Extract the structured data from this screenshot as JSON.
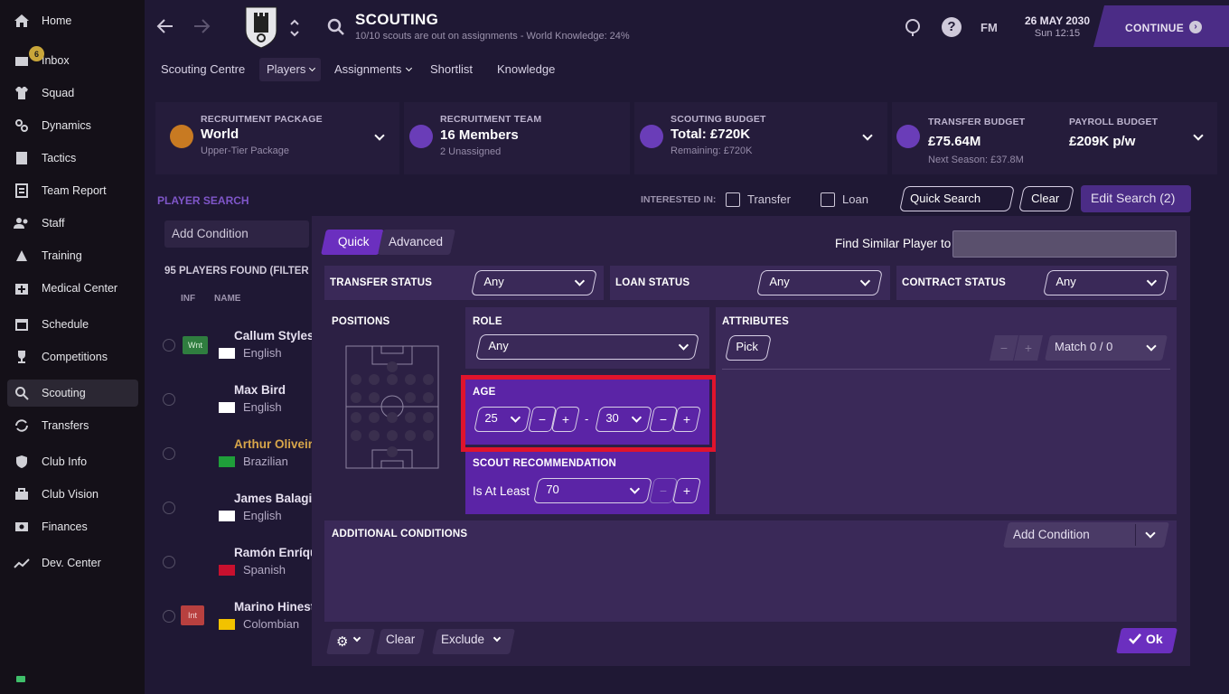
{
  "sidebar": {
    "items": [
      {
        "label": "Home",
        "icon": "home-icon"
      },
      {
        "label": "Inbox",
        "icon": "inbox-icon",
        "badge": "6"
      },
      {
        "label": "Squad",
        "icon": "shirt-icon"
      },
      {
        "label": "Dynamics",
        "icon": "dynamics-icon"
      },
      {
        "label": "Tactics",
        "icon": "tactics-icon"
      },
      {
        "label": "Team Report",
        "icon": "report-icon"
      },
      {
        "label": "Staff",
        "icon": "staff-icon"
      },
      {
        "label": "Training",
        "icon": "training-icon"
      },
      {
        "label": "Medical Center",
        "icon": "medical-icon"
      },
      {
        "label": "Schedule",
        "icon": "calendar-icon"
      },
      {
        "label": "Competitions",
        "icon": "trophy-icon"
      },
      {
        "label": "Scouting",
        "icon": "search-icon"
      },
      {
        "label": "Transfers",
        "icon": "transfer-icon"
      },
      {
        "label": "Club Info",
        "icon": "shield-icon"
      },
      {
        "label": "Club Vision",
        "icon": "briefcase-icon"
      },
      {
        "label": "Finances",
        "icon": "finances-icon"
      },
      {
        "label": "Dev. Center",
        "icon": "dev-icon"
      }
    ]
  },
  "header": {
    "title": "SCOUTING",
    "subtitle": "10/10 scouts are out on assignments - World Knowledge: 24%",
    "fm": "FM",
    "date": "26 MAY 2030",
    "time": "Sun 12:15",
    "continue": "CONTINUE"
  },
  "subtabs": {
    "scouting_centre": "Scouting Centre",
    "players": "Players",
    "assignments": "Assignments",
    "shortlist": "Shortlist",
    "knowledge": "Knowledge"
  },
  "cards": {
    "recruitment_package": {
      "label": "RECRUITMENT PACKAGE",
      "value": "World",
      "sub": "Upper-Tier Package"
    },
    "recruitment_team": {
      "label": "RECRUITMENT TEAM",
      "value": "16 Members",
      "sub": "2 Unassigned"
    },
    "scouting_budget": {
      "label": "SCOUTING BUDGET",
      "value": "Total: £720K",
      "sub": "Remaining: £720K"
    },
    "transfer_budget": {
      "label": "TRANSFER BUDGET",
      "value": "£75.64M",
      "sub": "Next Season: £37.8M"
    },
    "payroll_budget": {
      "label": "PAYROLL BUDGET",
      "value": "£209K p/w"
    }
  },
  "search_bar": {
    "title": "PLAYER SEARCH",
    "interested_in": "INTERESTED IN:",
    "transfer": "Transfer",
    "loan": "Loan",
    "quick_search": "Quick Search",
    "clear": "Clear",
    "edit_search": "Edit Search (2)",
    "add_condition": "Add Condition"
  },
  "list": {
    "found": "95 PLAYERS FOUND (FILTER",
    "col_inf": "INF",
    "col_name": "NAME",
    "rows": [
      {
        "name": "Callum Styles",
        "nat": "English",
        "tag": "Wnt"
      },
      {
        "name": "Max Bird",
        "nat": "English"
      },
      {
        "name": "Arthur Oliveir",
        "nat": "Brazilian"
      },
      {
        "name": "James Balagiz",
        "nat": "English"
      },
      {
        "name": "Ramón Enríqu",
        "nat": "Spanish"
      },
      {
        "name": "Marino Hinest",
        "nat": "Colombian",
        "tag": "Int"
      }
    ]
  },
  "modal": {
    "tab_quick": "Quick",
    "tab_advanced": "Advanced",
    "find_similar": "Find Similar Player to",
    "find_similar_value": "",
    "transfer_status": {
      "label": "TRANSFER STATUS",
      "value": "Any"
    },
    "loan_status": {
      "label": "LOAN STATUS",
      "value": "Any"
    },
    "contract_status": {
      "label": "CONTRACT STATUS",
      "value": "Any"
    },
    "positions": "POSITIONS",
    "role": {
      "label": "ROLE",
      "value": "Any"
    },
    "age": {
      "label": "AGE",
      "min": "25",
      "max": "30",
      "dash": "-"
    },
    "scout_rec": {
      "label": "SCOUT RECOMMENDATION",
      "op": "Is At Least",
      "value": "70"
    },
    "attributes": {
      "label": "ATTRIBUTES",
      "pick": "Pick",
      "match": "Match 0 / 0"
    },
    "additional": {
      "label": "ADDITIONAL CONDITIONS",
      "add": "Add Condition"
    },
    "footer": {
      "clear": "Clear",
      "exclude": "Exclude",
      "ok": "Ok"
    },
    "minus": "−",
    "plus": "+"
  },
  "colors": {
    "accent": "#6b2fbf",
    "highlight": "#e0142c",
    "modal_bg": "#2c2044",
    "panel_bg": "#3a2958"
  }
}
